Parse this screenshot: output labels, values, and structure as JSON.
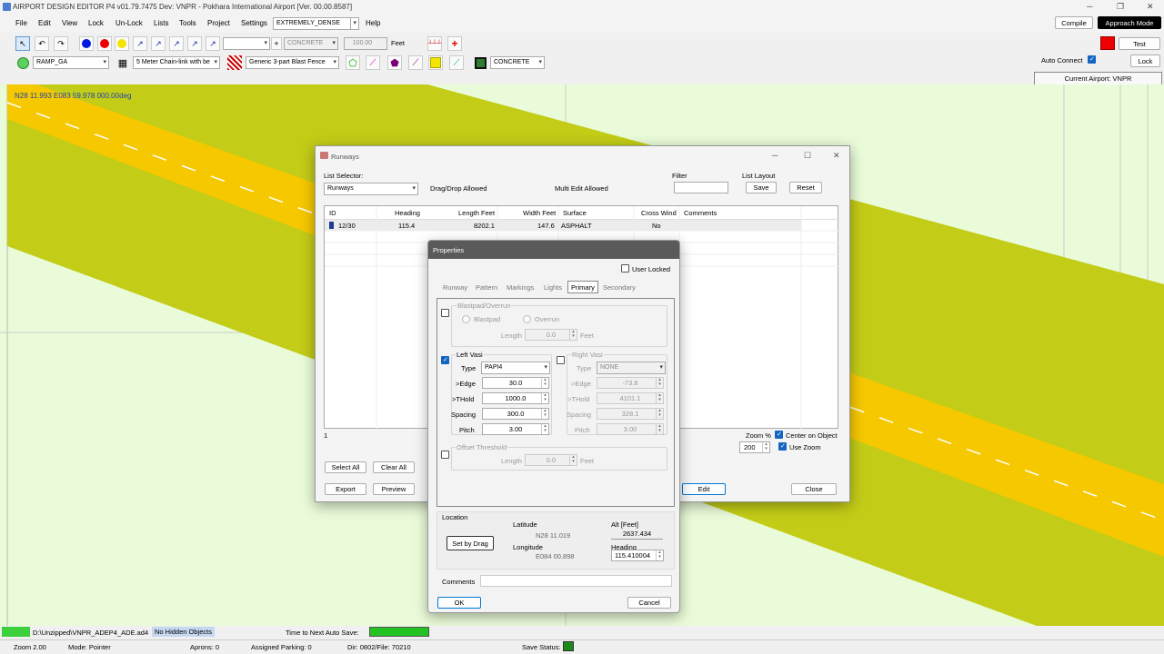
{
  "app": {
    "title": "AIRPORT DESIGN EDITOR P4  v01.79.7475 Dev: VNPR - Pokhara International Airport [Ver. 00.00.8587]"
  },
  "menu": [
    "File",
    "Edit",
    "View",
    "Lock",
    "Un-Lock",
    "Lists",
    "Tools",
    "Project",
    "Settings"
  ],
  "menu_help": "Help",
  "density": "EXTREMELY_DENSE",
  "toolbar": {
    "surface1": "CONCRETE",
    "size": "100.00",
    "unit": "Feet",
    "ramp": "RAMP_GA",
    "fence": "5 Meter Chain-link with be",
    "blast": "Generic 3-part Blast Fence",
    "surface2": "CONCRETE",
    "compile": "Compile",
    "approach": "Approach Mode",
    "test": "Test",
    "auto_connect": "Auto Connect",
    "lock": "Lock",
    "current_airport": "Current Airport: VNPR"
  },
  "map": {
    "coord": "N28 11.993   E083 59.978 000.00deg"
  },
  "runways": {
    "title": "Runways",
    "list_selector": "List Selector:",
    "selector_value": "Runways",
    "drag": "Drag/Drop Allowed",
    "multi": "Multi Edit Allowed",
    "filter": "Filter",
    "layout": "List Layout",
    "save": "Save",
    "reset": "Reset",
    "columns": [
      "ID",
      "Heading",
      "Length Feet",
      "Width Feet",
      "Surface",
      "Cross Wind",
      "Comments"
    ],
    "rows": [
      [
        "12/30",
        "115.4",
        "8202.1",
        "147.6",
        "ASPHALT",
        "No",
        ""
      ]
    ],
    "count": "1",
    "zoom_lbl": "Zoom %",
    "zoom": "200",
    "center": "Center on Object",
    "use_zoom": "Use Zoom",
    "select_all": "Select All",
    "clear_all": "Clear All",
    "export": "Export",
    "preview": "Preview",
    "edit": "Edit",
    "close": "Close"
  },
  "props": {
    "title": "Properties",
    "user_locked": "User Locked",
    "tabs": [
      "Runway",
      "Pattern",
      "Markings",
      "Lights",
      "Primary",
      "Secondary"
    ],
    "blast_grp": "Blastpad/Overrun",
    "blastpad": "Blastpad",
    "overrun": "Overrun",
    "length": "Length",
    "len_val": "0.0",
    "feet": "Feet",
    "left_vasi": "Left Vasi",
    "right_vasi": "Right Vasi",
    "type": "Type",
    "lv_type": "PAPI4",
    "rv_type": "NONE",
    "edge": ">Edge",
    "thold": ">THold",
    "spacing": "Spacing",
    "pitch": "Pitch",
    "lv": {
      "edge": "30.0",
      "thold": "1000.0",
      "spacing": "300.0",
      "pitch": "3.00"
    },
    "rv": {
      "edge": "-73.8",
      "thold": "4101.1",
      "spacing": "328.1",
      "pitch": "3.00"
    },
    "offset": "Offset Threshold",
    "off_len": "0.0",
    "location": "Location",
    "set_drag": "Set by Drag",
    "latitude": "Latitude",
    "lat_val": "N28 11.019",
    "longitude": "Longitude",
    "lon_val": "E084 00.898",
    "alt": "Alt [Feet]",
    "alt_val": "2637.434",
    "heading": "Heading",
    "hdg_val": "115.410004",
    "comments": "Comments",
    "ok": "OK",
    "cancel": "Cancel"
  },
  "status": {
    "file": "D:\\Unzipped\\VNPR_ADEP4_ADE.ad4",
    "hidden": "No Hidden Objects",
    "autosave": "Time to Next Auto Save:",
    "zoom": "Zoom 2.00",
    "mode": "Mode: Pointer",
    "aprons": "Aprons: 0",
    "parking": "Assigned Parking: 0",
    "dir": "Dir: 0802/File: 70210",
    "save": "Save Status:"
  }
}
